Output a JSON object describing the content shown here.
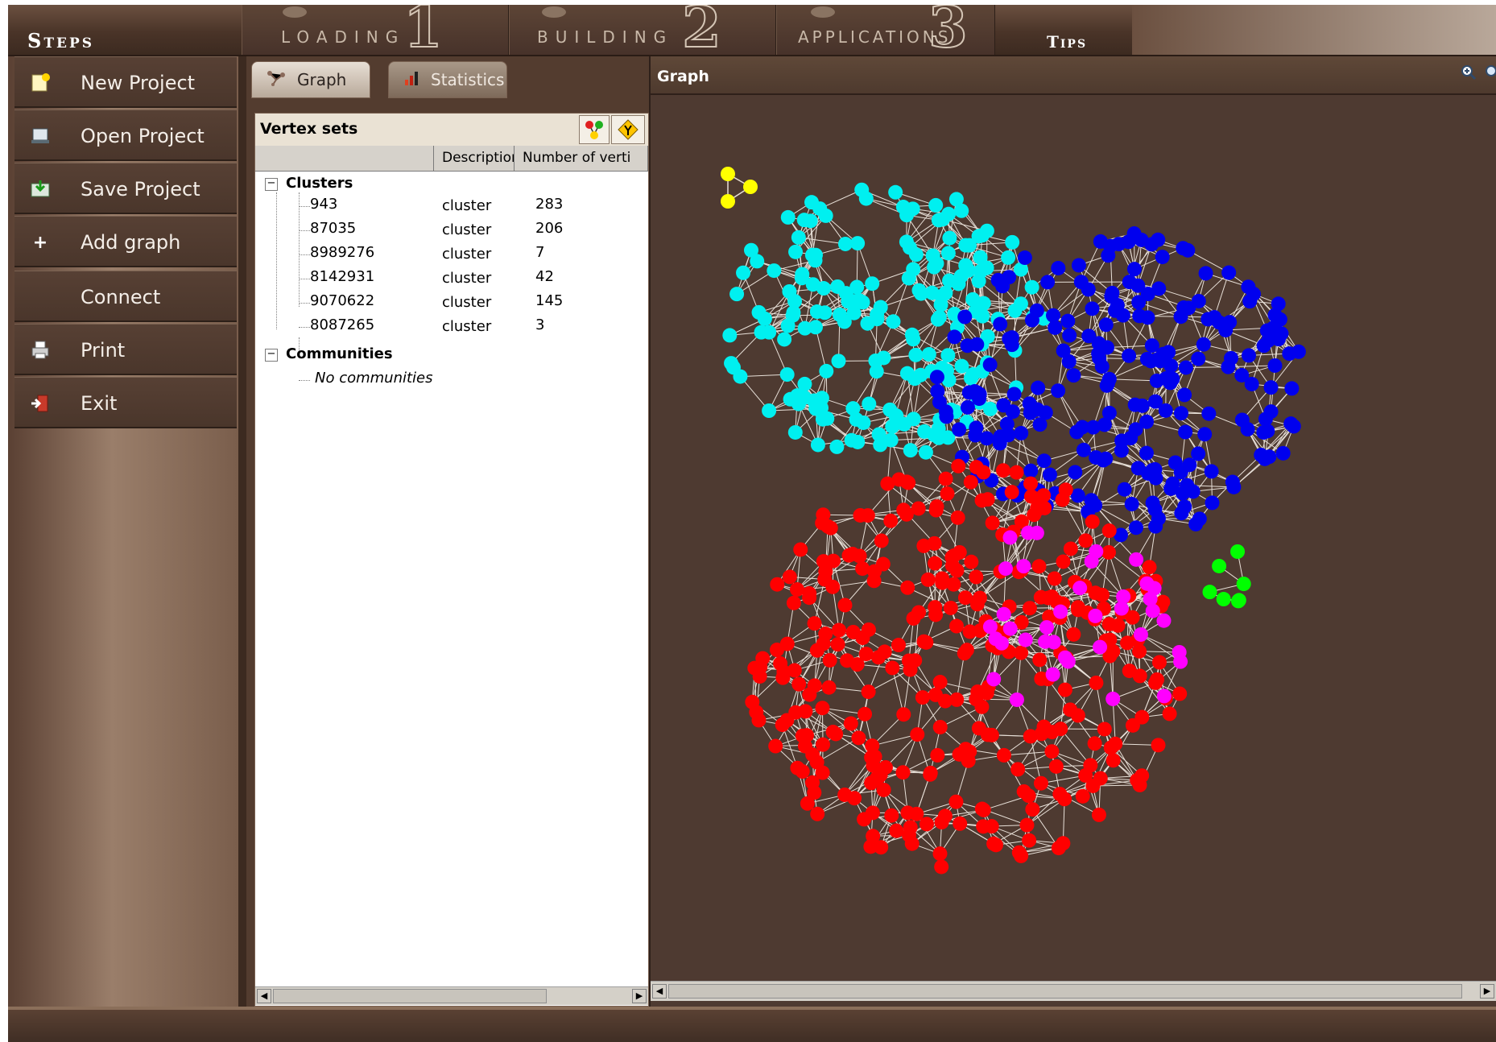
{
  "steps_bar": {
    "title": "Steps",
    "steps": [
      {
        "label": "LOADING",
        "number": "1"
      },
      {
        "label": "BUILDING",
        "number": "2"
      },
      {
        "label": "APPLICATIONS",
        "number": "3"
      }
    ],
    "tips": "Tips"
  },
  "sidebar": {
    "items": [
      {
        "label": "New Project",
        "icon": "new-project-icon"
      },
      {
        "label": "Open Project",
        "icon": "open-project-icon"
      },
      {
        "label": "Save Project",
        "icon": "save-project-icon"
      },
      {
        "label": "Add graph",
        "icon": "plus-icon"
      },
      {
        "label": "Connect",
        "icon": ""
      },
      {
        "label": "Print",
        "icon": "printer-icon"
      },
      {
        "label": "Exit",
        "icon": "exit-icon"
      }
    ]
  },
  "tabs": [
    {
      "label": "Graph",
      "icon": "graph-icon",
      "active": true
    },
    {
      "label": "Statistics",
      "icon": "bar-chart-icon",
      "active": false
    }
  ],
  "vertex_sets": {
    "title": "Vertex sets",
    "columns": [
      "",
      "Description",
      "Number of verti"
    ],
    "groups": [
      {
        "name": "Clusters",
        "rows": [
          {
            "id": "943",
            "description": "cluster",
            "count": "283"
          },
          {
            "id": "87035",
            "description": "cluster",
            "count": "206"
          },
          {
            "id": "8989276",
            "description": "cluster",
            "count": "7"
          },
          {
            "id": "8142931",
            "description": "cluster",
            "count": "42"
          },
          {
            "id": "9070622",
            "description": "cluster",
            "count": "145"
          },
          {
            "id": "8087265",
            "description": "cluster",
            "count": "3"
          }
        ]
      },
      {
        "name": "Communities",
        "empty_text": "No communities"
      }
    ]
  },
  "graph_panel": {
    "title": "Graph"
  },
  "colors": {
    "red": "#ff0000",
    "blue": "#0000ee",
    "cyan": "#00f0f0",
    "magenta": "#ff00ff",
    "green": "#00ff00",
    "yellow": "#ffff00",
    "edge": "#e8e0d8",
    "panel_brown": "#4e3a31"
  }
}
